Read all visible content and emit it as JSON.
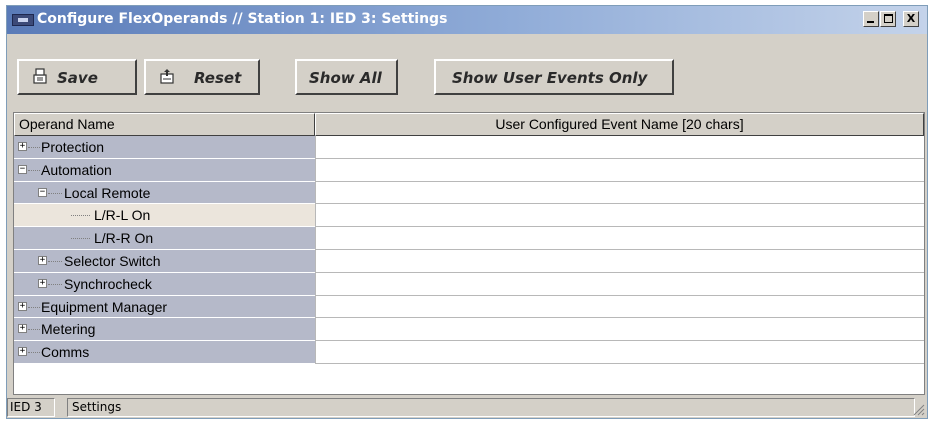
{
  "window": {
    "title": "Configure FlexOperands // Station 1: IED 3: Settings",
    "app_icon": "window-icon",
    "controls": {
      "minimize_glyph": "_",
      "maximize_glyph": "□",
      "close_glyph": "X"
    }
  },
  "toolbar": {
    "save_label": "Save",
    "save_icon": "save-icon",
    "reset_label": "Reset",
    "reset_icon": "reset-icon",
    "show_all_label": "Show All",
    "show_user_events_label": "Show User Events Only"
  },
  "table": {
    "columns": [
      "Operand Name",
      "User Configured Event Name [20 chars]"
    ],
    "rows": [
      {
        "name": "Protection",
        "expander": "+",
        "event_name": ""
      },
      {
        "name": "Automation",
        "expander": "−",
        "event_name": ""
      },
      {
        "name": "Local Remote",
        "expander": "−",
        "event_name": ""
      },
      {
        "name": "L/R-L On",
        "selected": true,
        "event_name": ""
      },
      {
        "name": "L/R-R On",
        "event_name": ""
      },
      {
        "name": "Selector Switch",
        "expander": "+",
        "event_name": ""
      },
      {
        "name": "Synchrocheck",
        "expander": "+",
        "event_name": ""
      },
      {
        "name": "Equipment Manager",
        "expander": "+",
        "event_name": ""
      },
      {
        "name": "Metering",
        "expander": "+",
        "event_name": ""
      },
      {
        "name": "Comms",
        "expander": "+",
        "event_name": ""
      }
    ]
  },
  "status": {
    "device": "IED 3",
    "section": "Settings"
  },
  "colors": {
    "tree_column": "#b5b9c9",
    "selected_row": "#ebe5dc",
    "titlebar_start": "#5a7bb8",
    "chrome": "#d4d0c8"
  }
}
